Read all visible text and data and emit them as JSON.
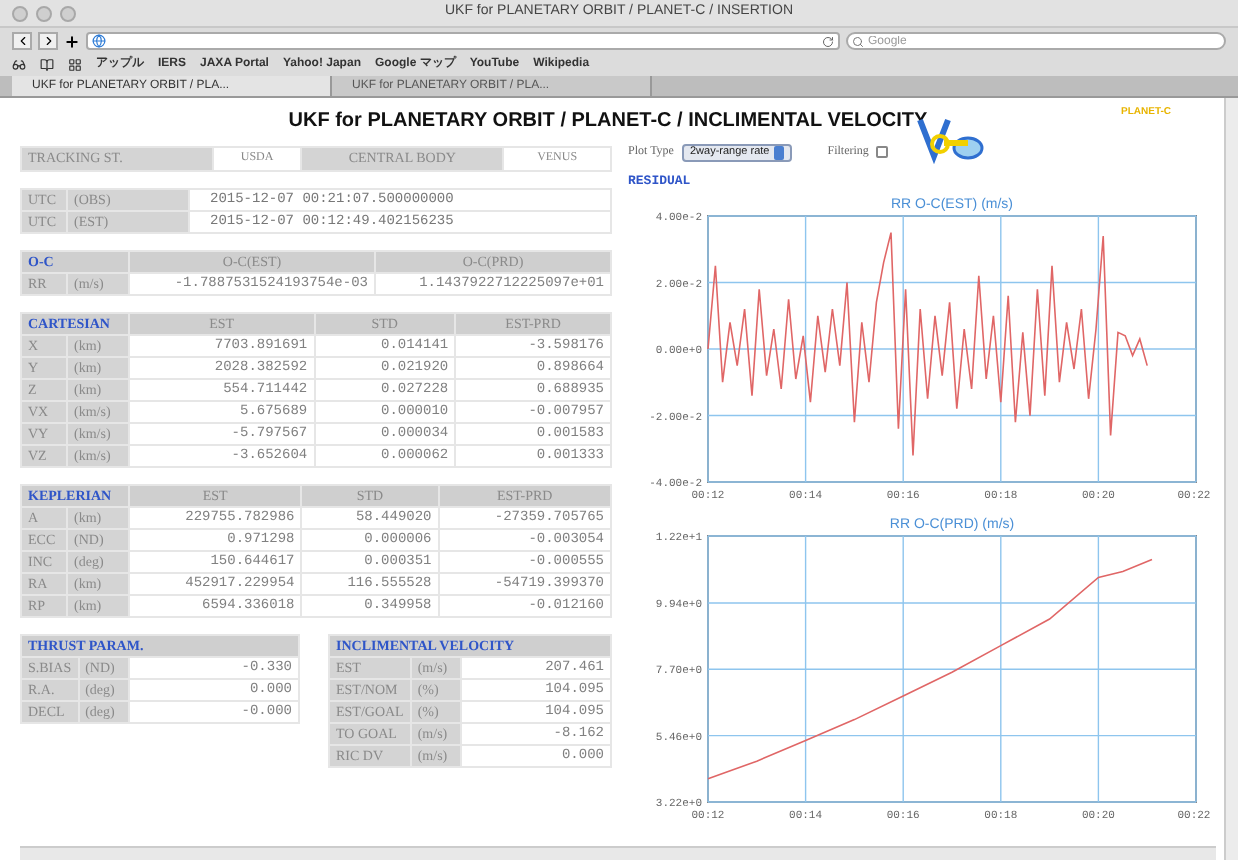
{
  "window": {
    "title": "UKF for PLANETARY ORBIT / PLANET-C / INSERTION"
  },
  "toolbar": {
    "search_placeholder": "Google"
  },
  "bookmarks": [
    "アップル",
    "IERS",
    "JAXA Portal",
    "Yahoo! Japan",
    "Google マップ",
    "YouTube",
    "Wikipedia"
  ],
  "tabs": [
    {
      "label": "UKF for PLANETARY ORBIT / PLA...",
      "selected": true
    },
    {
      "label": "UKF for PLANETARY ORBIT / PLA...",
      "selected": false
    }
  ],
  "page": {
    "title": "UKF for PLANETARY ORBIT / PLANET-C / INCLIMENTAL VELOCITY"
  },
  "tracking": {
    "label": "TRACKING ST.",
    "station": "USDA",
    "body_label": "CENTRAL BODY",
    "body": "VENUS"
  },
  "utc": [
    {
      "label": "UTC",
      "unit": "(OBS)",
      "value": "2015-12-07 00:21:07.500000000"
    },
    {
      "label": "UTC",
      "unit": "(EST)",
      "value": "2015-12-07 00:12:49.402156235"
    }
  ],
  "oc": {
    "title": "O-C",
    "columns": [
      "O-C(EST)",
      "O-C(PRD)"
    ],
    "rows": [
      {
        "label": "RR",
        "unit": "(m/s)",
        "values": [
          "-1.7887531524193754e-03",
          "1.1437922712225097e+01"
        ]
      }
    ]
  },
  "cartesian": {
    "title": "CARTESIAN",
    "columns": [
      "EST",
      "STD",
      "EST-PRD"
    ],
    "rows": [
      {
        "label": "X",
        "unit": "(km)",
        "values": [
          "7703.891691",
          "0.014141",
          "-3.598176"
        ]
      },
      {
        "label": "Y",
        "unit": "(km)",
        "values": [
          "2028.382592",
          "0.021920",
          "0.898664"
        ]
      },
      {
        "label": "Z",
        "unit": "(km)",
        "values": [
          "554.711442",
          "0.027228",
          "0.688935"
        ]
      },
      {
        "label": "VX",
        "unit": "(km/s)",
        "values": [
          "5.675689",
          "0.000010",
          "-0.007957"
        ]
      },
      {
        "label": "VY",
        "unit": "(km/s)",
        "values": [
          "-5.797567",
          "0.000034",
          "0.001583"
        ]
      },
      {
        "label": "VZ",
        "unit": "(km/s)",
        "values": [
          "-3.652604",
          "0.000062",
          "0.001333"
        ]
      }
    ]
  },
  "keplerian": {
    "title": "KEPLERIAN",
    "columns": [
      "EST",
      "STD",
      "EST-PRD"
    ],
    "rows": [
      {
        "label": "A",
        "unit": "(km)",
        "values": [
          "229755.782986",
          "58.449020",
          "-27359.705765"
        ]
      },
      {
        "label": "ECC",
        "unit": "(ND)",
        "values": [
          "0.971298",
          "0.000006",
          "-0.003054"
        ]
      },
      {
        "label": "INC",
        "unit": "(deg)",
        "values": [
          "150.644617",
          "0.000351",
          "-0.000555"
        ]
      },
      {
        "label": "RA",
        "unit": "(km)",
        "values": [
          "452917.229954",
          "116.555528",
          "-54719.399370"
        ]
      },
      {
        "label": "RP",
        "unit": "(km)",
        "values": [
          "6594.336018",
          "0.349958",
          "-0.012160"
        ]
      }
    ]
  },
  "thrust": {
    "title": "THRUST PARAM.",
    "rows": [
      {
        "label": "S.BIAS",
        "unit": "(ND)",
        "value": "-0.330"
      },
      {
        "label": "R.A.",
        "unit": "(deg)",
        "value": "0.000"
      },
      {
        "label": "DECL",
        "unit": "(deg)",
        "value": "-0.000"
      }
    ]
  },
  "velocity": {
    "title": "INCLIMENTAL VELOCITY",
    "rows": [
      {
        "label": "EST",
        "unit": "(m/s)",
        "value": "207.461"
      },
      {
        "label": "EST/NOM",
        "unit": "(%)",
        "value": "104.095"
      },
      {
        "label": "EST/GOAL",
        "unit": "(%)",
        "value": "104.095"
      },
      {
        "label": "TO GOAL",
        "unit": "(m/s)",
        "value": "-8.162"
      },
      {
        "label": "RIC DV",
        "unit": "(m/s)",
        "value": "0.000"
      }
    ]
  },
  "controls": {
    "plot_type_label": "Plot Type",
    "plot_type": "2way-range rate",
    "filtering_label": "Filtering",
    "filtering": false
  },
  "logo": {
    "text": "PLANET-C"
  },
  "residual": {
    "heading": "RESIDUAL",
    "charts": [
      {
        "chart_data": {
          "type": "line",
          "title": "RR O-C(EST) (m/s)",
          "x": [
            12.0,
            12.15,
            12.3,
            12.45,
            12.6,
            12.75,
            12.9,
            13.05,
            13.2,
            13.35,
            13.5,
            13.65,
            13.8,
            13.95,
            14.1,
            14.25,
            14.4,
            14.55,
            14.7,
            14.85,
            15.0,
            15.15,
            15.3,
            15.45,
            15.6,
            15.75,
            15.9,
            16.05,
            16.2,
            16.35,
            16.5,
            16.65,
            16.8,
            16.95,
            17.1,
            17.25,
            17.4,
            17.55,
            17.7,
            17.85,
            18.0,
            18.15,
            18.3,
            18.45,
            18.6,
            18.75,
            18.9,
            19.05,
            19.2,
            19.35,
            19.5,
            19.65,
            19.8,
            19.95,
            20.1,
            20.25,
            20.4,
            20.55,
            20.7,
            20.85,
            21.0
          ],
          "grid": true,
          "series": [
            {
              "color": "#e06666",
              "values": [
                0.0,
                0.025,
                -0.01,
                0.008,
                -0.005,
                0.012,
                -0.014,
                0.018,
                -0.008,
                0.006,
                -0.012,
                0.015,
                -0.009,
                0.004,
                -0.016,
                0.01,
                -0.007,
                0.012,
                -0.005,
                0.02,
                -0.022,
                0.008,
                -0.01,
                0.014,
                0.026,
                0.035,
                -0.024,
                0.018,
                -0.032,
                0.012,
                -0.015,
                0.01,
                -0.008,
                0.014,
                -0.018,
                0.006,
                -0.012,
                0.022,
                -0.009,
                0.01,
                -0.016,
                0.016,
                -0.022,
                0.005,
                -0.02,
                0.018,
                -0.014,
                0.025,
                -0.01,
                0.008,
                -0.006,
                0.012,
                -0.015,
                0.006,
                0.034,
                -0.026,
                0.005,
                0.004,
                -0.002,
                0.003,
                -0.005
              ]
            }
          ],
          "xlim": [
            12,
            22
          ],
          "ylim": [
            -0.04,
            0.04
          ],
          "xticks": [
            {
              "value": 12,
              "label": "00:12"
            },
            {
              "value": 14,
              "label": "00:14"
            },
            {
              "value": 16,
              "label": "00:16"
            },
            {
              "value": 18,
              "label": "00:18"
            },
            {
              "value": 20,
              "label": "00:20"
            },
            {
              "value": 22,
              "label": "00:22"
            }
          ],
          "yticks": [
            {
              "value": -0.04,
              "label": "-4.00e-2"
            },
            {
              "value": -0.02,
              "label": "-2.00e-2"
            },
            {
              "value": 0,
              "label": "0.00e+0"
            },
            {
              "value": 0.02,
              "label": "2.00e-2"
            },
            {
              "value": 0.04,
              "label": "4.00e-2"
            }
          ]
        }
      },
      {
        "chart_data": {
          "type": "line",
          "title": "RR O-C(PRD) (m/s)",
          "x": [
            12,
            13,
            14,
            15,
            16,
            17,
            18,
            19,
            20,
            20.5,
            21.1
          ],
          "grid": true,
          "series": [
            {
              "color": "#e06666",
              "values": [
                4.0,
                4.6,
                5.3,
                6.0,
                6.8,
                7.6,
                8.5,
                9.4,
                10.8,
                11.0,
                11.4
              ]
            }
          ],
          "xlim": [
            12,
            22
          ],
          "ylim": [
            3.22,
            12.2
          ],
          "xticks": [
            {
              "value": 12,
              "label": "00:12"
            },
            {
              "value": 14,
              "label": "00:14"
            },
            {
              "value": 16,
              "label": "00:16"
            },
            {
              "value": 18,
              "label": "00:18"
            },
            {
              "value": 20,
              "label": "00:20"
            },
            {
              "value": 22,
              "label": "00:22"
            }
          ],
          "yticks": [
            {
              "value": 3.22,
              "label": "3.22e+0"
            },
            {
              "value": 5.46,
              "label": "5.46e+0"
            },
            {
              "value": 7.7,
              "label": "7.70e+0"
            },
            {
              "value": 9.94,
              "label": "9.94e+0"
            },
            {
              "value": 12.2,
              "label": "1.22e+1"
            }
          ]
        }
      }
    ]
  }
}
